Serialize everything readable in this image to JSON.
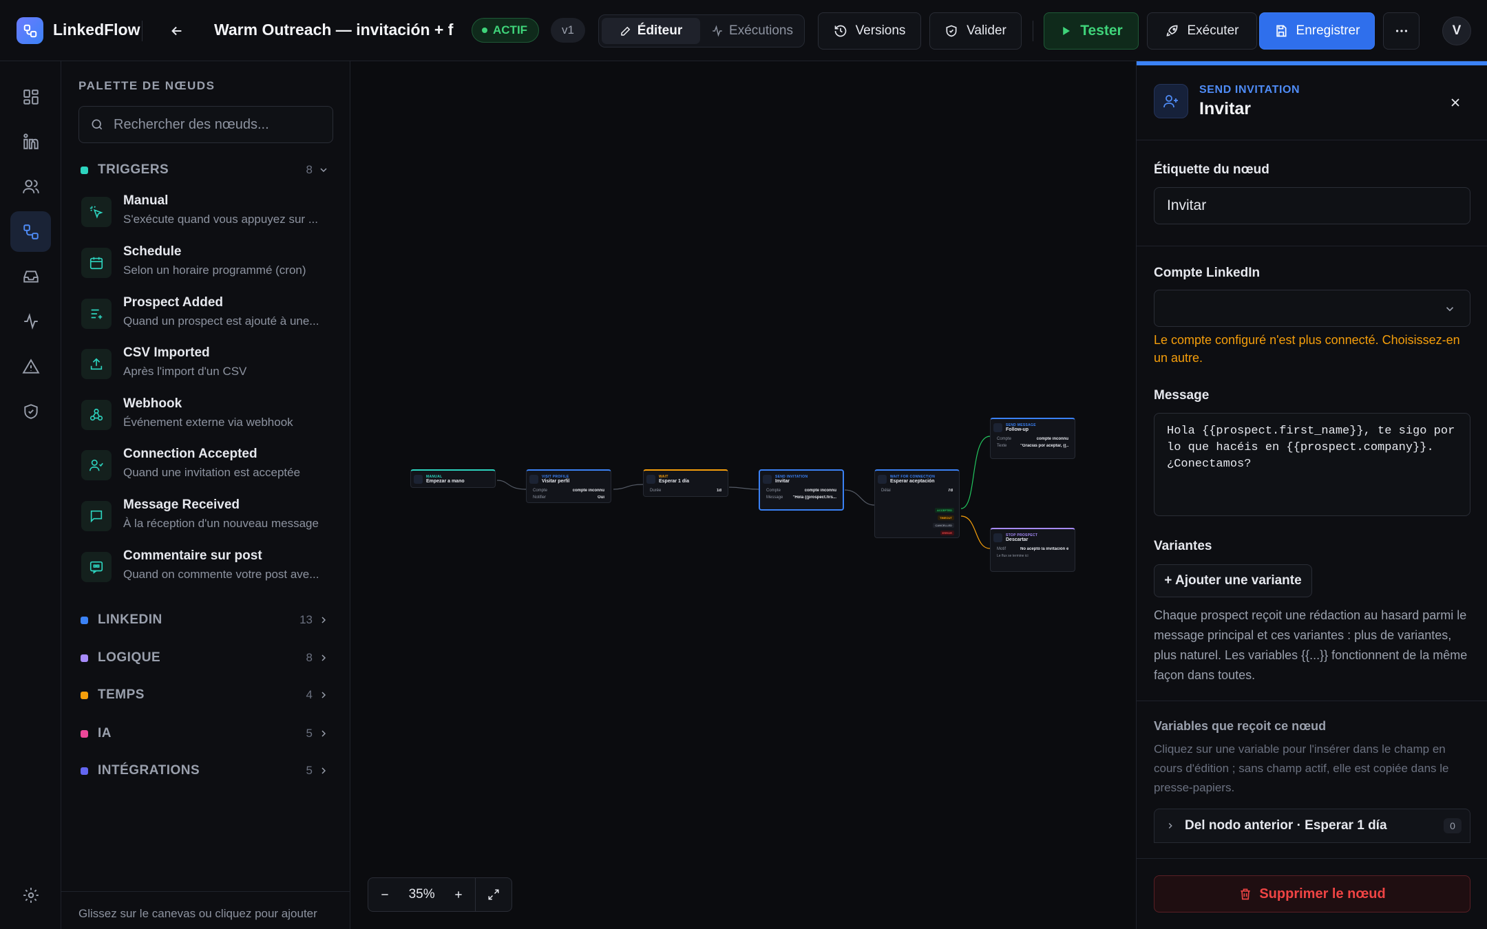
{
  "app": {
    "name": "LinkedFlow"
  },
  "header": {
    "workflow_title": "Warm Outreach — invitación + follow-up",
    "status": "ACTIF",
    "version": "v1",
    "tabs": [
      {
        "label": "Éditeur",
        "active": true
      },
      {
        "label": "Exécutions",
        "active": false
      }
    ],
    "versions": "Versions",
    "validate": "Valider",
    "test": "Tester",
    "run": "Exécuter",
    "save": "Enregistrer",
    "user_initial": "V"
  },
  "rail": {
    "items": [
      "dashboard-icon",
      "linkedin-icon",
      "users-icon",
      "workflows-icon",
      "inbox-icon",
      "activity-icon",
      "alert-icon",
      "shield-icon"
    ],
    "settings": "gear-icon"
  },
  "palette": {
    "title": "PALETTE DE NŒUDS",
    "search_placeholder": "Rechercher des nœuds...",
    "categories": [
      {
        "name": "TRIGGERS",
        "count": "8",
        "color": "#2dd4bf",
        "open": true
      },
      {
        "name": "LINKEDIN",
        "count": "13",
        "color": "#3b82f6"
      },
      {
        "name": "LOGIQUE",
        "count": "8",
        "color": "#a78bfa"
      },
      {
        "name": "TEMPS",
        "count": "4",
        "color": "#f59e0b"
      },
      {
        "name": "IA",
        "count": "5",
        "color": "#ec4899"
      },
      {
        "name": "INTÉGRATIONS",
        "count": "5",
        "color": "#6366f1"
      }
    ],
    "triggers": [
      {
        "name": "Manual",
        "desc": "S'exécute quand vous appuyez sur ...",
        "icon": "pointer-icon"
      },
      {
        "name": "Schedule",
        "desc": "Selon un horaire programmé (cron)",
        "icon": "calendar-icon"
      },
      {
        "name": "Prospect Added",
        "desc": "Quand un prospect est ajouté à une...",
        "icon": "list-plus-icon"
      },
      {
        "name": "CSV Imported",
        "desc": "Après l'import d'un CSV",
        "icon": "upload-icon"
      },
      {
        "name": "Webhook",
        "desc": "Événement externe via webhook",
        "icon": "webhook-icon"
      },
      {
        "name": "Connection Accepted",
        "desc": "Quand une invitation est acceptée",
        "icon": "user-check-icon"
      },
      {
        "name": "Message Received",
        "desc": "À la réception d'un nouveau message",
        "icon": "message-icon"
      },
      {
        "name": "Commentaire sur post",
        "desc": "Quand on commente votre post ave...",
        "icon": "comment-icon"
      }
    ],
    "footer": "Glissez sur le canevas ou cliquez pour ajouter"
  },
  "canvas": {
    "zoom": "35%",
    "nodes": [
      {
        "type": "MANUAL",
        "label": "Empezar a mano",
        "color": "#2dd4bf",
        "rows": []
      },
      {
        "type": "VISIT PROFILE",
        "label": "Visitar perfil",
        "color": "#3b82f6",
        "rows": [
          {
            "k": "Compte",
            "v": "compte inconnu"
          },
          {
            "k": "Notifier",
            "v": "Oui"
          }
        ]
      },
      {
        "type": "WAIT",
        "label": "Esperar 1 día",
        "color": "#f59e0b",
        "rows": [
          {
            "k": "Durée",
            "v": "1d"
          }
        ]
      },
      {
        "type": "SEND INVITATION",
        "label": "Invitar",
        "color": "#3b82f6",
        "rows": [
          {
            "k": "Compte",
            "v": "compte inconnu"
          },
          {
            "k": "Message",
            "v": "\"Hola {{prospect.firs..."
          }
        ]
      },
      {
        "type": "WAIT FOR CONNECTION",
        "label": "Esperar aceptación",
        "color": "#3b82f6",
        "rows": [
          {
            "k": "Délai",
            "v": "7d"
          }
        ],
        "branches": [
          "ACCEPTED",
          "TIMEOUT",
          "CANCELLED",
          "ERROR"
        ]
      },
      {
        "type": "SEND MESSAGE",
        "label": "Follow-up",
        "color": "#3b82f6",
        "rows": [
          {
            "k": "Compte",
            "v": "compte inconnu"
          },
          {
            "k": "Texte",
            "v": "\"Gracias por aceptar, {{..."
          }
        ]
      },
      {
        "type": "STOP PROSPECT",
        "label": "Descartar",
        "color": "#a78bfa",
        "rows": [
          {
            "k": "Motif",
            "v": "No aceptó la invitación e..."
          }
        ],
        "note": "Le flux se termine ici"
      }
    ]
  },
  "panel": {
    "node_type": "SEND INVITATION",
    "node_name": "Invitar",
    "label_field": "Étiquette du nœud",
    "label_value": "Invitar",
    "account_field": "Compte LinkedIn",
    "account_value": "",
    "account_warning": "Le compte configuré n'est plus connecté. Choisissez-en un autre.",
    "message_field": "Message",
    "message_value": "Hola {{prospect.first_name}}, te sigo por lo que hacéis en {{prospect.company}}. ¿Conectamos?",
    "variants_field": "Variantes",
    "add_variant": "+ Ajouter une variante",
    "variants_help": "Chaque prospect reçoit une rédaction au hasard parmi le message principal et ces variantes : plus de variantes, plus naturel. Les variables {{...}} fonctionnent de la même façon dans toutes.",
    "vars_title": "Variables que reçoit ce nœud",
    "vars_help": "Cliquez sur une variable pour l'insérer dans le champ en cours d'édition ; sans champ actif, elle est copiée dans le presse-papiers.",
    "vars_group": "Del nodo anterior · Esperar 1 día",
    "vars_group_count": "0",
    "delete": "Supprimer le nœud"
  }
}
